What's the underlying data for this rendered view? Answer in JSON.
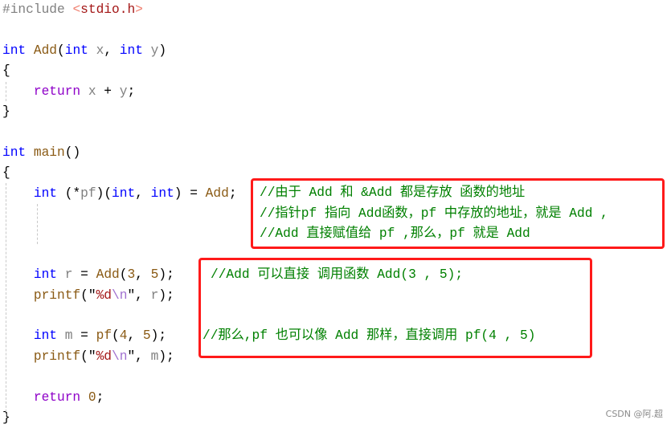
{
  "colors": {
    "keyword": "#0000ff",
    "return_keyword": "#8e00c8",
    "function": "#8a5a14",
    "variable": "#808080",
    "preprocessor": "#808080",
    "header": "#a31515",
    "bracket": "#f07f6f",
    "string": "#a31515",
    "escape": "#a070d0",
    "number": "#8a5a14",
    "plain": "#000000",
    "comment": "#008000",
    "highlight_box": "#ff1a1a"
  },
  "code_lines": [
    [
      {
        "t": "#include ",
        "c": "preprocessor"
      },
      {
        "t": "<",
        "c": "bracket"
      },
      {
        "t": "stdio.h",
        "c": "header"
      },
      {
        "t": ">",
        "c": "bracket"
      }
    ],
    [],
    [
      {
        "t": "int",
        "c": "keyword"
      },
      {
        "t": " "
      },
      {
        "t": "Add",
        "c": "function"
      },
      {
        "t": "("
      },
      {
        "t": "int",
        "c": "keyword"
      },
      {
        "t": " "
      },
      {
        "t": "x",
        "c": "variable"
      },
      {
        "t": ", "
      },
      {
        "t": "int",
        "c": "keyword"
      },
      {
        "t": " "
      },
      {
        "t": "y",
        "c": "variable"
      },
      {
        "t": ")"
      }
    ],
    [
      {
        "t": "{"
      }
    ],
    [
      {
        "t": "    "
      },
      {
        "t": "return",
        "c": "return_keyword"
      },
      {
        "t": " "
      },
      {
        "t": "x",
        "c": "variable"
      },
      {
        "t": " + "
      },
      {
        "t": "y",
        "c": "variable"
      },
      {
        "t": ";"
      }
    ],
    [
      {
        "t": "}"
      }
    ],
    [],
    [
      {
        "t": "int",
        "c": "keyword"
      },
      {
        "t": " "
      },
      {
        "t": "main",
        "c": "function"
      },
      {
        "t": "()"
      }
    ],
    [
      {
        "t": "{"
      }
    ],
    [
      {
        "t": "    "
      },
      {
        "t": "int",
        "c": "keyword"
      },
      {
        "t": " (*"
      },
      {
        "t": "pf",
        "c": "variable"
      },
      {
        "t": ")("
      },
      {
        "t": "int",
        "c": "keyword"
      },
      {
        "t": ", "
      },
      {
        "t": "int",
        "c": "keyword"
      },
      {
        "t": ") = "
      },
      {
        "t": "Add",
        "c": "function"
      },
      {
        "t": ";"
      }
    ],
    [],
    [],
    [],
    [
      {
        "t": "    "
      },
      {
        "t": "int",
        "c": "keyword"
      },
      {
        "t": " "
      },
      {
        "t": "r",
        "c": "variable"
      },
      {
        "t": " = "
      },
      {
        "t": "Add",
        "c": "function"
      },
      {
        "t": "("
      },
      {
        "t": "3",
        "c": "number"
      },
      {
        "t": ", "
      },
      {
        "t": "5",
        "c": "number"
      },
      {
        "t": ");"
      }
    ],
    [
      {
        "t": "    "
      },
      {
        "t": "printf",
        "c": "function"
      },
      {
        "t": "(\""
      },
      {
        "t": "%d",
        "c": "string"
      },
      {
        "t": "\\n",
        "c": "escape"
      },
      {
        "t": "\", "
      },
      {
        "t": "r",
        "c": "variable"
      },
      {
        "t": ");"
      }
    ],
    [],
    [
      {
        "t": "    "
      },
      {
        "t": "int",
        "c": "keyword"
      },
      {
        "t": " "
      },
      {
        "t": "m",
        "c": "variable"
      },
      {
        "t": " = "
      },
      {
        "t": "pf",
        "c": "function"
      },
      {
        "t": "("
      },
      {
        "t": "4",
        "c": "number"
      },
      {
        "t": ", "
      },
      {
        "t": "5",
        "c": "number"
      },
      {
        "t": ");"
      }
    ],
    [
      {
        "t": "    "
      },
      {
        "t": "printf",
        "c": "function"
      },
      {
        "t": "(\""
      },
      {
        "t": "%d",
        "c": "string"
      },
      {
        "t": "\\n",
        "c": "escape"
      },
      {
        "t": "\", "
      },
      {
        "t": "m",
        "c": "variable"
      },
      {
        "t": ");"
      }
    ],
    [],
    [
      {
        "t": "    "
      },
      {
        "t": "return",
        "c": "return_keyword"
      },
      {
        "t": " "
      },
      {
        "t": "0",
        "c": "number"
      },
      {
        "t": ";"
      }
    ],
    [
      {
        "t": "}"
      }
    ]
  ],
  "comments": {
    "c1": "//由于 Add 和 &Add 都是存放 函数的地址",
    "c2": "//指针pf 指向 Add函数，pf 中存放的地址，就是 Add ,",
    "c3": "//Add 直接赋值给 pf ,那么，pf 就是 Add",
    "c4": "//Add 可以直接 调用函数 Add(3 , 5);",
    "c5": "//那么,pf 也可以像 Add 那样，直接调用 pf(4 , 5)"
  },
  "watermark": "CSDN @阿.超"
}
